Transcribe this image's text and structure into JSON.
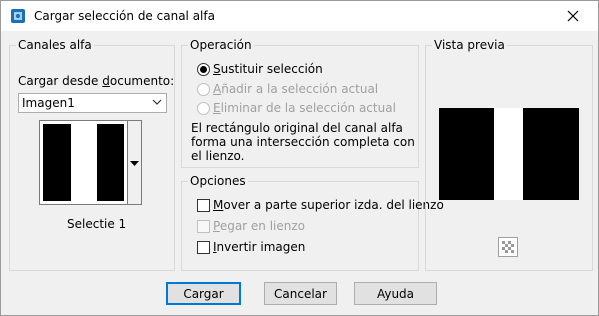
{
  "window": {
    "title": "Cargar selección de canal alfa",
    "icon": "app-icon",
    "close_icon": "close-icon"
  },
  "canales": {
    "legend": "Canales alfa",
    "load_label_pre": "Cargar desde ",
    "load_label_u": "d",
    "load_label_post": "ocumento:",
    "document_value": "Imagen1",
    "channel_name": "Selectie 1"
  },
  "operacion": {
    "legend": "Operación",
    "options": [
      {
        "u": "S",
        "rest": "ustituir selección",
        "selected": true,
        "enabled": true
      },
      {
        "u": "A",
        "rest": "ñadir a la selección actual",
        "selected": false,
        "enabled": false
      },
      {
        "u": "E",
        "rest": "liminar de la selección actual",
        "selected": false,
        "enabled": false
      }
    ],
    "description_line1": "El rectángulo original del canal alfa",
    "description_line2": "forma una intersección completa con",
    "description_line3": "el lienzo."
  },
  "opciones": {
    "legend": "Opciones",
    "items": [
      {
        "u": "M",
        "rest": "over a parte superior izda. del lienzo",
        "checked": false,
        "enabled": true
      },
      {
        "u": "P",
        "rest": "egar en lienzo",
        "checked": false,
        "enabled": false
      },
      {
        "u": "I",
        "rest": "nvertir imagen",
        "checked": false,
        "enabled": true
      }
    ]
  },
  "preview": {
    "legend": "Vista previa",
    "zoom_icon": "checkerboard-icon"
  },
  "buttons": {
    "ok": "Cargar",
    "cancel": "Cancelar",
    "help": "Ayuda"
  },
  "colors": {
    "accent": "#0078d7",
    "window_bg": "#f0f0f0"
  }
}
